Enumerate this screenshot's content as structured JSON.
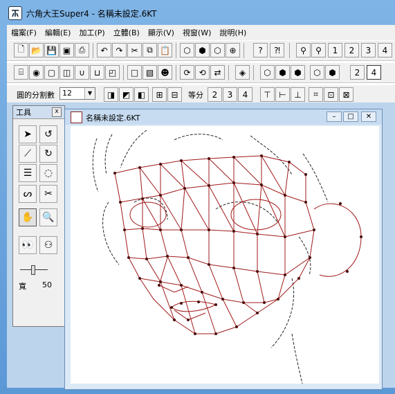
{
  "window": {
    "title": "六角大王Super4 - 名稱未設定.6KT"
  },
  "menu": [
    "檔案(F)",
    "編輯(E)",
    "加工(P)",
    "立體(B)",
    "顯示(V)",
    "視窗(W)",
    "說明(H)"
  ],
  "toolbar1": {
    "icons": [
      "new-file-icon",
      "open-folder-icon",
      "save-icon",
      "save-all-icon",
      "print-icon",
      "undo-icon",
      "redo-icon",
      "cut-icon",
      "copy-icon",
      "paste-icon",
      "view-front-icon",
      "view-side-icon",
      "view-top-icon",
      "view-perspective-icon",
      "help-icon",
      "context-help-icon",
      "camera-left-icon",
      "camera-right-icon"
    ],
    "numbers": [
      "1",
      "2",
      "3",
      "4"
    ]
  },
  "toolbar2": {
    "numbers": [
      "2",
      "4"
    ]
  },
  "toolbar3": {
    "division_label": "圓的分割數",
    "division_value": "12",
    "equal_label": "等分",
    "equal_numbers": [
      "2",
      "3",
      "4"
    ]
  },
  "palette": {
    "title": "工具",
    "close": "x",
    "width_label": "寬",
    "width_value": "50"
  },
  "document": {
    "title": "名稱未設定.6KT",
    "minimize": "–",
    "maximize": "□",
    "close": "✕"
  },
  "colors": {
    "mesh": "#a01818",
    "sketch": "#222222",
    "accent": "#5b9bd5"
  }
}
